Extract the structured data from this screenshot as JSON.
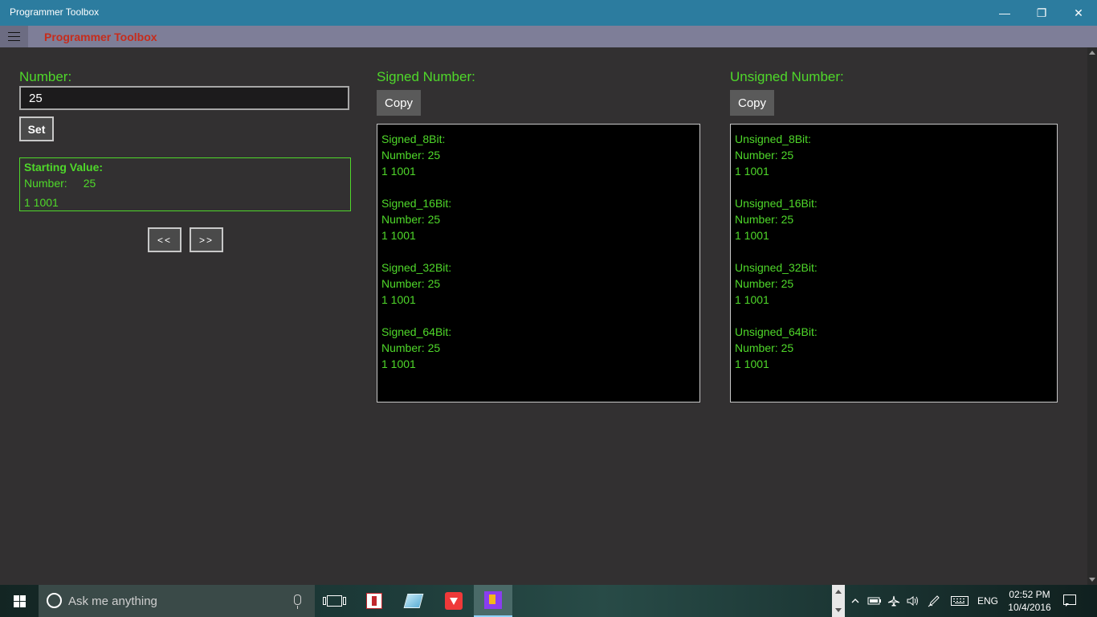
{
  "window": {
    "title": "Programmer Toolbox",
    "minimize_glyph": "—",
    "restore_glyph": "❐",
    "close_glyph": "✕"
  },
  "app": {
    "title": "Programmer Toolbox"
  },
  "number_panel": {
    "label": "Number:",
    "input_value": "25",
    "set_label": "Set",
    "starting_value": {
      "heading": "Starting Value:",
      "number_label": "Number:",
      "number_value": "25",
      "binary": "1 1001"
    },
    "prev_label": "<<",
    "next_label": ">>"
  },
  "signed_panel": {
    "label": "Signed Number:",
    "copy_label": "Copy",
    "blocks": [
      {
        "name": "Signed_8Bit:",
        "number": "Number: 25",
        "binary": "1 1001"
      },
      {
        "name": "Signed_16Bit:",
        "number": "Number: 25",
        "binary": "1 1001"
      },
      {
        "name": "Signed_32Bit:",
        "number": "Number: 25",
        "binary": "1 1001"
      },
      {
        "name": "Signed_64Bit:",
        "number": "Number: 25",
        "binary": "1 1001"
      }
    ]
  },
  "unsigned_panel": {
    "label": "Unsigned Number:",
    "copy_label": "Copy",
    "blocks": [
      {
        "name": "Unsigned_8Bit:",
        "number": "Number: 25",
        "binary": "1 1001"
      },
      {
        "name": "Unsigned_16Bit:",
        "number": "Number: 25",
        "binary": "1 1001"
      },
      {
        "name": "Unsigned_32Bit:",
        "number": "Number: 25",
        "binary": "1 1001"
      },
      {
        "name": "Unsigned_64Bit:",
        "number": "Number: 25",
        "binary": "1 1001"
      }
    ]
  },
  "taskbar": {
    "search_placeholder": "Ask me anything",
    "language": "ENG",
    "time": "02:52 PM",
    "date": "10/4/2016",
    "tray_icons": [
      "chevron-up-icon",
      "battery-icon",
      "airplane-icon",
      "volume-icon",
      "pen-icon",
      "keyboard-icon"
    ]
  },
  "colors": {
    "accent_green": "#4fd82a",
    "titlebar": "#2c7c9f",
    "app_title_red": "#c62c1c"
  }
}
